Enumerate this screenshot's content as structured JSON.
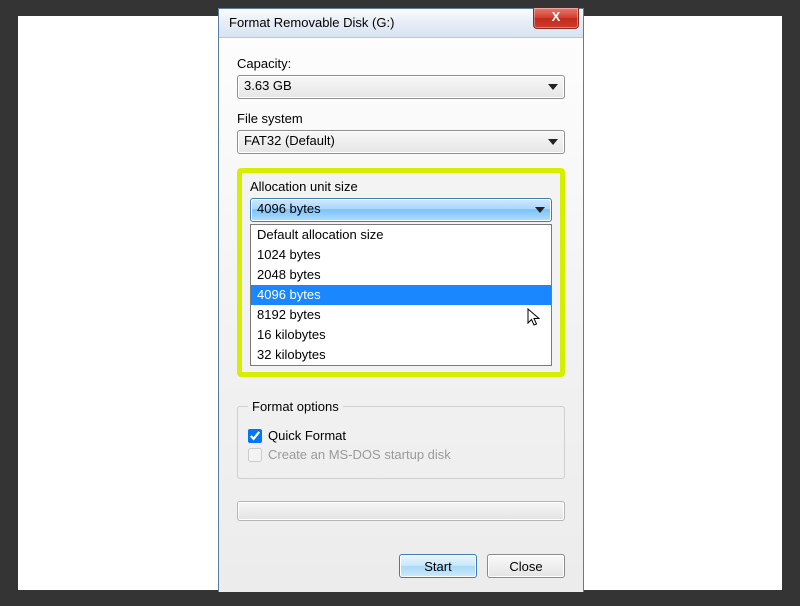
{
  "window": {
    "title": "Format Removable Disk (G:)"
  },
  "capacity": {
    "label": "Capacity:",
    "value": "3.63 GB"
  },
  "filesystem": {
    "label": "File system",
    "value": "FAT32 (Default)"
  },
  "allocation": {
    "label": "Allocation unit size",
    "value": "4096 bytes",
    "options": [
      "Default allocation size",
      "1024 bytes",
      "2048 bytes",
      "4096 bytes",
      "8192 bytes",
      "16 kilobytes",
      "32 kilobytes"
    ],
    "selected_index": 3
  },
  "format_options": {
    "legend": "Format options",
    "quick_format": {
      "label": "Quick Format",
      "checked": true
    },
    "msdos": {
      "label": "Create an MS-DOS startup disk",
      "checked": false,
      "enabled": false
    }
  },
  "buttons": {
    "start": "Start",
    "close": "Close"
  }
}
